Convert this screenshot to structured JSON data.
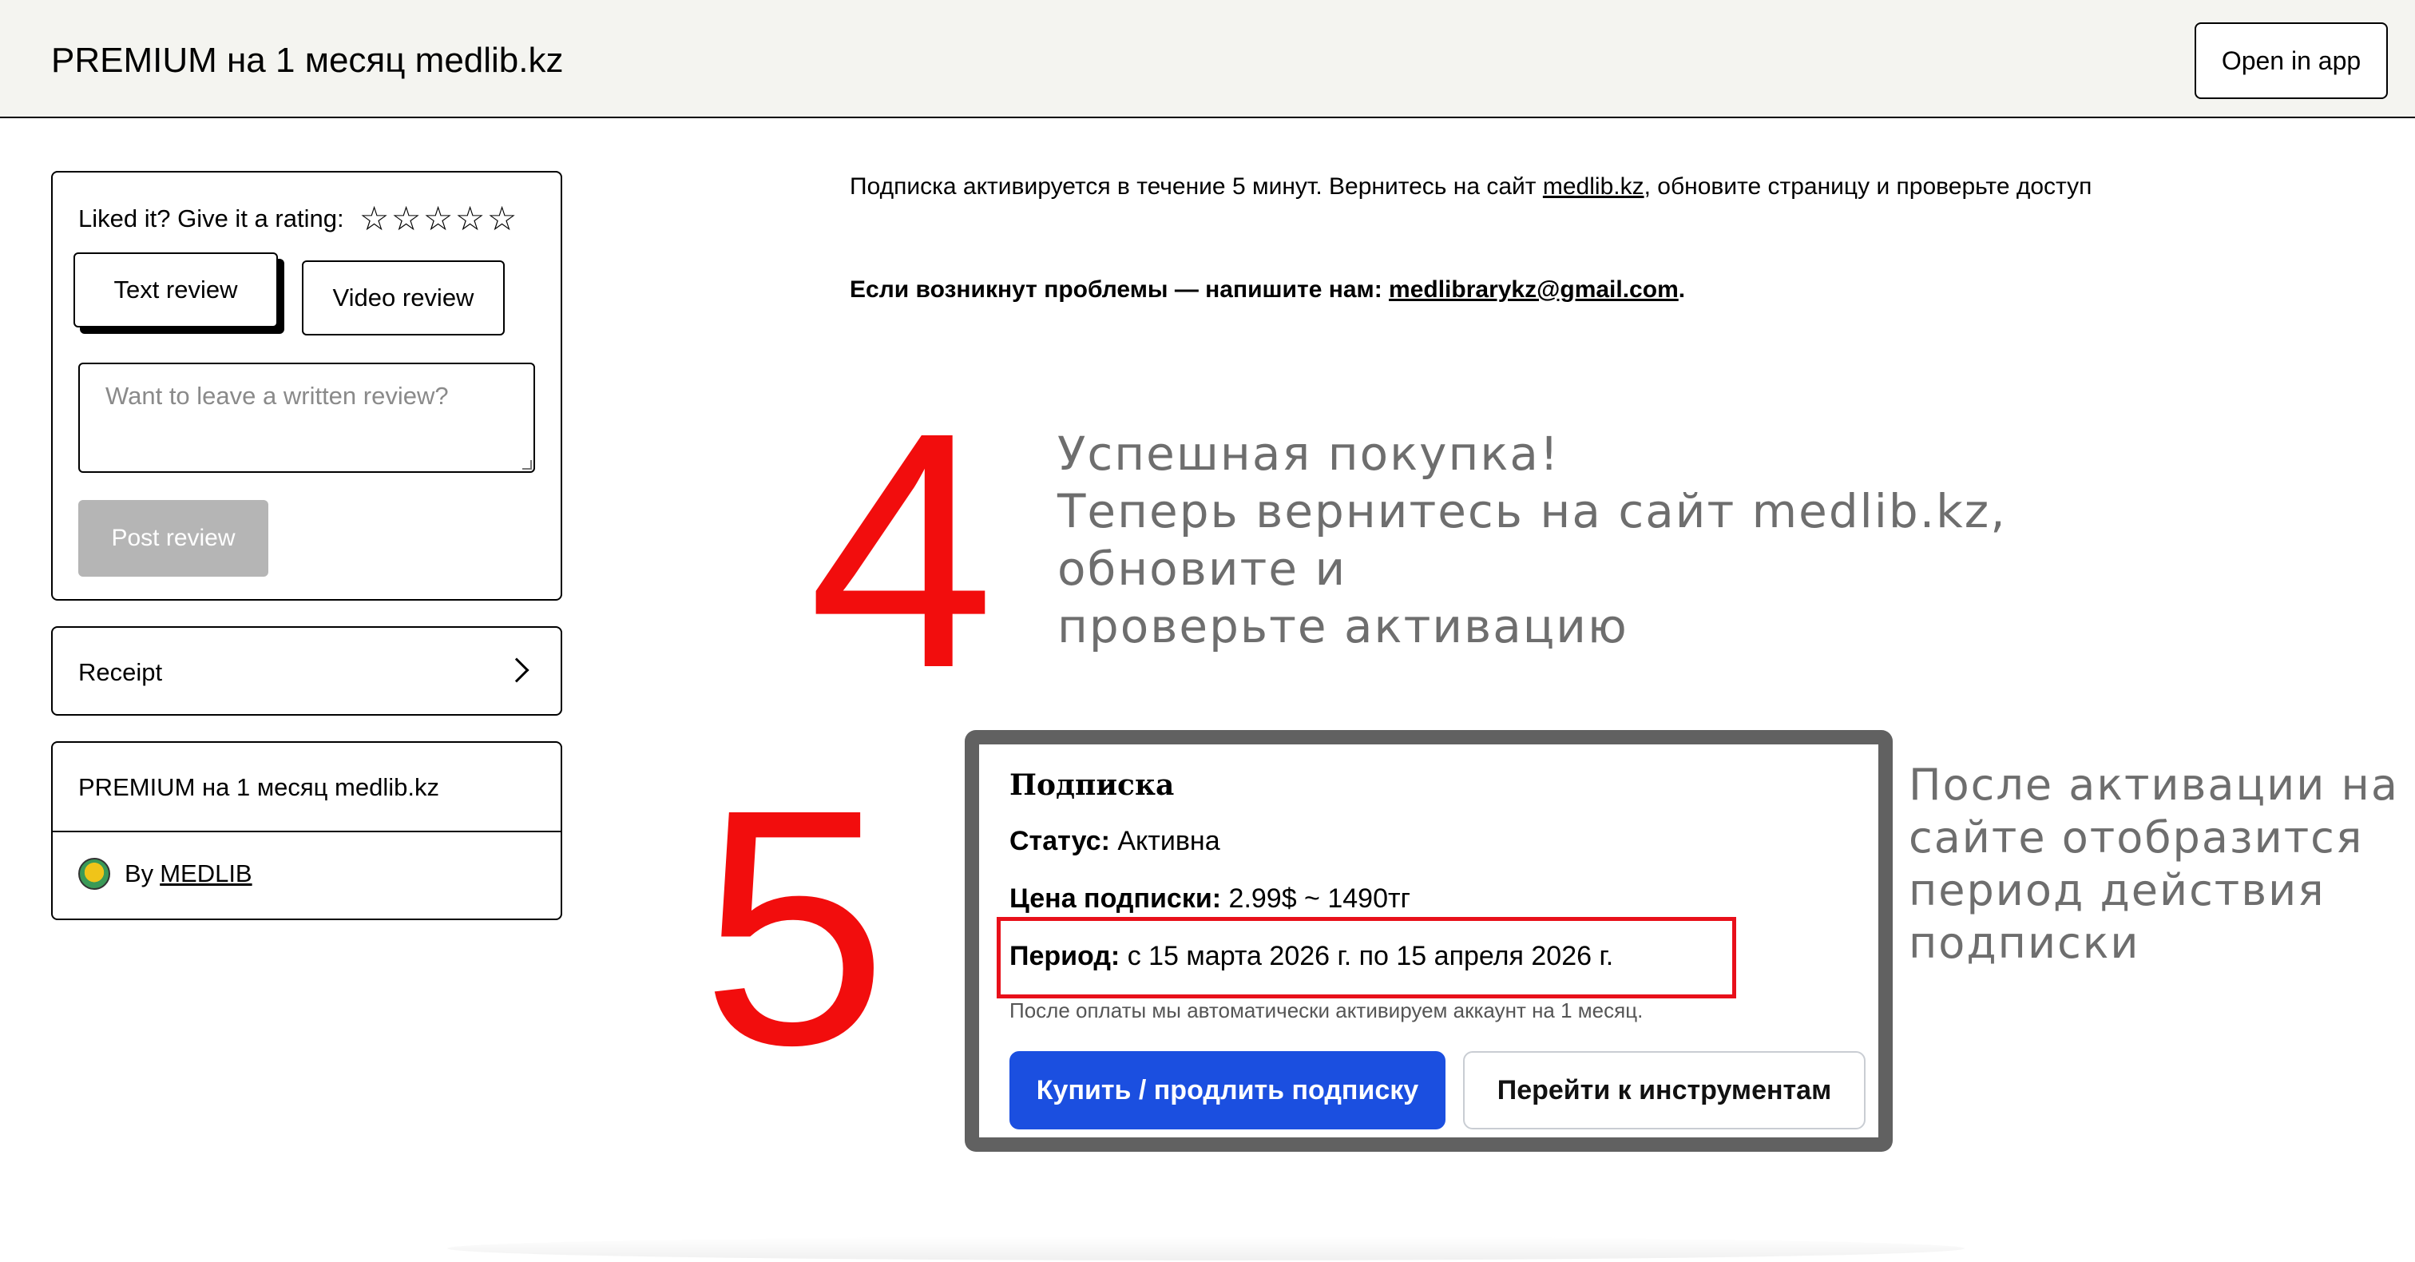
{
  "header": {
    "title": "PREMIUM на 1 месяц medlib.kz",
    "open_in_app": "Open in app"
  },
  "review": {
    "rating_label": "Liked it? Give it a rating:",
    "stars": [
      "☆",
      "☆",
      "☆",
      "☆",
      "☆"
    ],
    "tab_text": "Text review",
    "tab_video": "Video review",
    "placeholder": "Want to leave a written review?",
    "post_button": "Post review"
  },
  "receipt": {
    "label": "Receipt"
  },
  "product": {
    "name": "PREMIUM на 1 месяц medlib.kz",
    "by": "By",
    "seller": "MEDLIB"
  },
  "info": {
    "part1": "Подписка активируется в течение 5 минут. Вернитесь на сайт ",
    "site_link": "medlib.kz",
    "part2": ", обновите страницу и проверьте доступ",
    "problem_prefix": "Если возникнут проблемы — напишите нам: ",
    "email": "medlibrarykz@gmail.com",
    "problem_suffix": "."
  },
  "annotations": {
    "step4": "4",
    "step5": "5",
    "success_lines": [
      "Успешная покупка!",
      "Теперь вернитесь на сайт medlib.kz,",
      "обновите и",
      "проверьте активацию"
    ],
    "after_activation": "После активации на сайте отобразится период действия подписки",
    "highlight_color": "#e8101a",
    "number_color": "#f20d0d"
  },
  "subscription": {
    "title": "Подписка",
    "status_label": "Статус:",
    "status_value": "Активна",
    "price_label": "Цена подписки:",
    "price_value": "2.99$ ~ 1490тг",
    "period_label": "Период:",
    "period_value": "с 15 марта 2026 г. по 15 апреля 2026 г.",
    "note": "После оплаты мы автоматически активируем аккаунт на 1 месяц.",
    "buy_button": "Купить / продлить подписку",
    "tools_button": "Перейти к инструментам",
    "buy_color": "#1b4fe0"
  }
}
